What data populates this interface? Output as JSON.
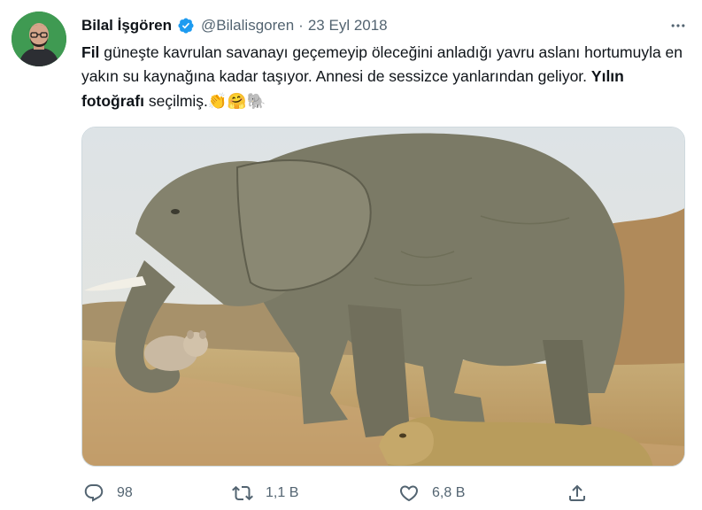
{
  "tweet": {
    "author_name": "Bilal İşgören",
    "handle": "@Bilalisgoren",
    "separator": "·",
    "date": "23 Eyl 2018",
    "more_label": "···",
    "text": {
      "bold1": "Fil",
      "part1": " güneşte kavrulan savanayı geçemeyip öleceğini anladığı yavru aslanı hortumuyla en yakın su kaynağına kadar taşıyor. Annesi de sessizce yanlarından geliyor. ",
      "bold2": "Yılın fotoğrafı",
      "part2": " seçilmiş.",
      "emojis": "👏🤗🐘"
    },
    "media": {
      "icons": [
        "elephant",
        "lion-cub",
        "lioness"
      ]
    }
  },
  "actions": {
    "reply_count": "98",
    "retweet_count": "1,1 B",
    "like_count": "6,8 B"
  },
  "colors": {
    "verified": "#1d9bf0",
    "secondary_text": "#536471",
    "primary_text": "#0f1419",
    "avatar_bg": "#3f9a52"
  }
}
